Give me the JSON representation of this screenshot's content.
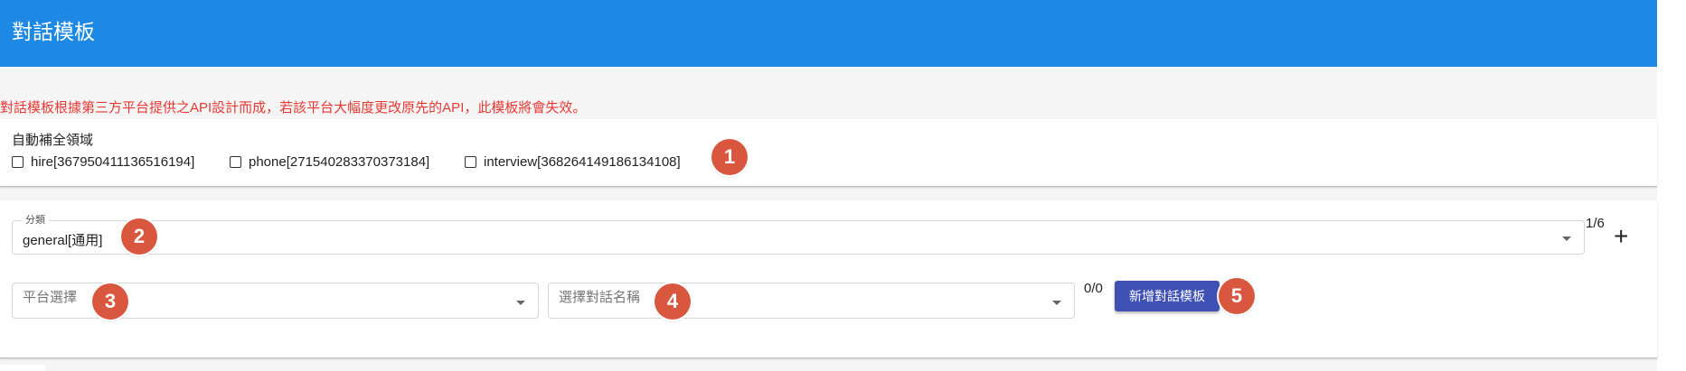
{
  "header": {
    "title": "對話模板"
  },
  "notice": "對話模板根據第三方平台提供之API設計而成，若該平台大幅度更改原先的API，此模板將會失效。",
  "autocomplete": {
    "label": "自動補全領域",
    "options": [
      {
        "label": "hire[367950411136516194]",
        "checked": false
      },
      {
        "label": "phone[271540283370373184]",
        "checked": false
      },
      {
        "label": "interview[368264149186134108]",
        "checked": false
      }
    ]
  },
  "category": {
    "legend": "分類",
    "value": "general[通用]",
    "counter": "1/6",
    "add_label": "+"
  },
  "platform": {
    "placeholder": "平台選擇"
  },
  "dialog_name": {
    "placeholder": "選擇對話名稱",
    "counter": "0/0"
  },
  "add_template_button": "新增對話模板",
  "badges": [
    "1",
    "2",
    "3",
    "4",
    "5"
  ],
  "colors": {
    "header_bg": "#1e88e5",
    "notice_text": "#e53935",
    "primary_button": "#3f51b5",
    "badge": "#d9563f"
  }
}
